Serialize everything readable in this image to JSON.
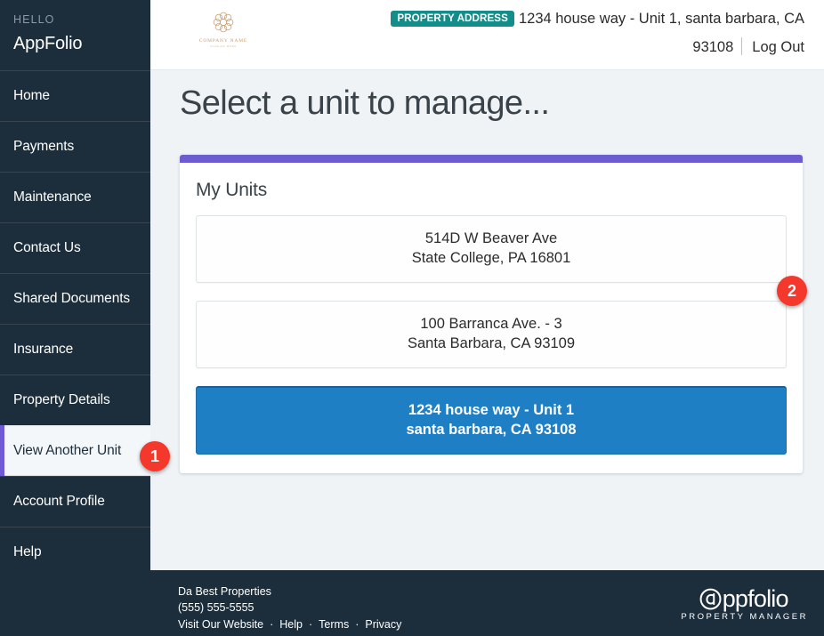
{
  "sidebar": {
    "greeting_label": "HELLO",
    "account_name": "AppFolio",
    "items": [
      {
        "label": "Home",
        "active": false
      },
      {
        "label": "Payments",
        "active": false
      },
      {
        "label": "Maintenance",
        "active": false
      },
      {
        "label": "Contact Us",
        "active": false
      },
      {
        "label": "Shared Documents",
        "active": false
      },
      {
        "label": "Insurance",
        "active": false
      },
      {
        "label": "Property Details",
        "active": false
      },
      {
        "label": "View Another Unit",
        "active": true
      },
      {
        "label": "Account Profile",
        "active": false
      },
      {
        "label": "Help",
        "active": false
      }
    ]
  },
  "header": {
    "logo": {
      "company_name": "COMPANY NAME",
      "tagline": "SLOGAN HERE",
      "icon": "floral-rosette-icon",
      "color": "#C49A6C"
    },
    "property_address_badge": "PROPERTY ADDRESS",
    "property_address_line1": "1234 house way - Unit 1, santa barbara, CA",
    "property_address_line2": "93108",
    "logout_label": "Log Out",
    "badge_color": "#138D8A"
  },
  "main": {
    "page_title": "Select a unit to manage...",
    "card": {
      "accent_color": "#6D5BD0",
      "title": "My Units",
      "units": [
        {
          "line1": "514D W Beaver Ave",
          "line2": "State College, PA 16801",
          "selected": false
        },
        {
          "line1": "100 Barranca Ave. - 3",
          "line2": "Santa Barbara, CA 93109",
          "selected": false
        },
        {
          "line1": "1234 house way - Unit 1",
          "line2": "santa barbara, CA 93108",
          "selected": true
        }
      ],
      "selected_color": "#1F7FC4"
    }
  },
  "footer": {
    "company": "Da Best Properties",
    "phone": "(555) 555-5555",
    "links": [
      {
        "label": "Visit Our Website"
      },
      {
        "label": "Help"
      },
      {
        "label": "Terms"
      },
      {
        "label": "Privacy"
      }
    ],
    "separator": "·",
    "brand_word": "ppfolio",
    "brand_sub": "PROPERTY MANAGER"
  },
  "annotations": [
    {
      "number": "1",
      "target": "View Another Unit sidebar item"
    },
    {
      "number": "2",
      "target": "My Units card"
    }
  ]
}
